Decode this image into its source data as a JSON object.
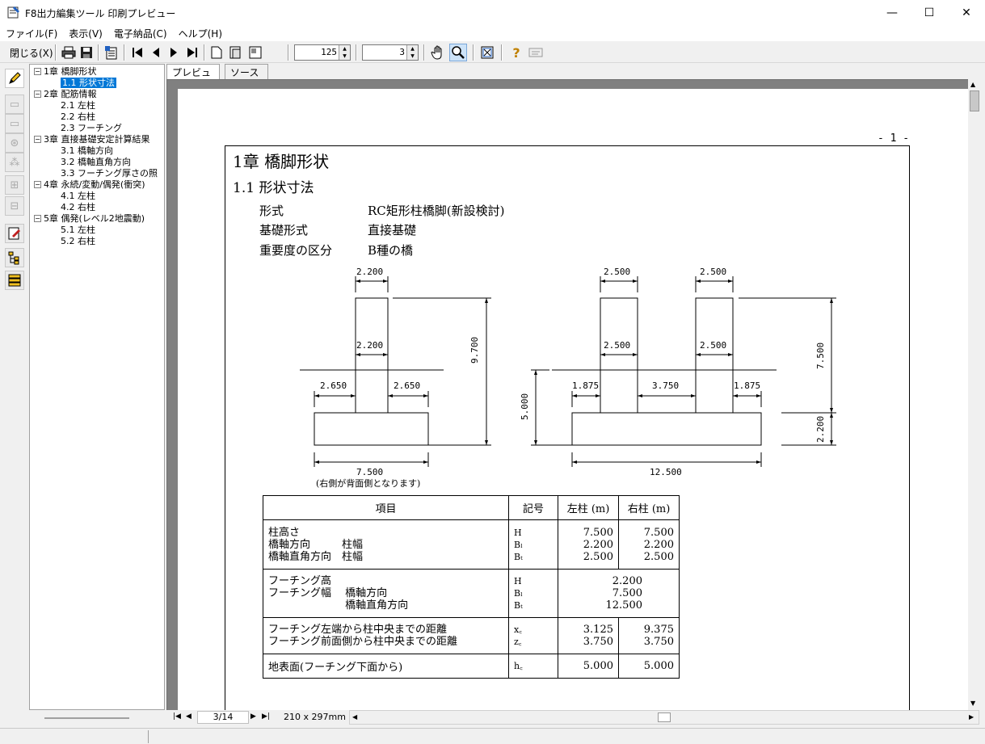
{
  "window": {
    "title": "F8出力編集ツール 印刷プレビュー",
    "minimize": "—",
    "maximize": "☐",
    "close": "✕"
  },
  "menu": [
    "ファイル(F)",
    "表示(V)",
    "電子納品(C)",
    "ヘルプ(H)"
  ],
  "toolbar": {
    "close_label": "閉じる(X)",
    "zoom_value": "125",
    "page_value": "3"
  },
  "tabs": [
    "プレビュー",
    "ソース"
  ],
  "tree": [
    {
      "label": "1章 橋脚形状",
      "level": 0,
      "box": "−"
    },
    {
      "label": "1.1 形状寸法",
      "level": 1,
      "selected": true
    },
    {
      "label": "2章 配筋情報",
      "level": 0,
      "box": "−"
    },
    {
      "label": "2.1 左柱",
      "level": 1
    },
    {
      "label": "2.2 右柱",
      "level": 1
    },
    {
      "label": "2.3 フーチング",
      "level": 1
    },
    {
      "label": "3章 直接基礎安定計算結果",
      "level": 0,
      "box": "−"
    },
    {
      "label": "3.1 橋軸方向",
      "level": 1
    },
    {
      "label": "3.2 橋軸直角方向",
      "level": 1
    },
    {
      "label": "3.3 フーチング厚さの照",
      "level": 1
    },
    {
      "label": "4章 永続/変動/偶発(衝突)",
      "level": 0,
      "box": "−"
    },
    {
      "label": "4.1 左柱",
      "level": 1
    },
    {
      "label": "4.2 右柱",
      "level": 1
    },
    {
      "label": "5章 偶発(レベル2地震動)",
      "level": 0,
      "box": "−"
    },
    {
      "label": "5.1 左柱",
      "level": 1
    },
    {
      "label": "5.2 右柱",
      "level": 1
    }
  ],
  "page": {
    "page_number": "- 1 -",
    "chapter": "1章  橋脚形状",
    "section": "1.1  形状寸法",
    "props": [
      {
        "k": "形式",
        "v": "RC矩形柱橋脚(新設検討)"
      },
      {
        "k": "基礎形式",
        "v": "直接基礎"
      },
      {
        "k": "重要度の区分",
        "v": "B種の橋"
      }
    ],
    "dims_left": {
      "top": "2.200",
      "mid": "2.200",
      "left": "2.650",
      "right": "2.650",
      "height": "9.700",
      "bottom": "7.500",
      "note": "(右側が背面側となります)"
    },
    "dims_right": {
      "top1": "2.500",
      "top2": "2.500",
      "mid1": "2.500",
      "mid2": "2.500",
      "h_left": "5.000",
      "l1": "1.875",
      "l2": "3.750",
      "l3": "1.875",
      "h_right_top": "7.500",
      "h_right_bot": "2.200",
      "bottom": "12.500"
    },
    "table": {
      "headers": [
        "項目",
        "記号",
        "左柱 (m)",
        "右柱 (m)"
      ],
      "g1": {
        "items": [
          "柱高さ",
          "橋軸方向　　　柱幅",
          "橋軸直角方向　柱幅"
        ],
        "sym": [
          "H",
          "Bₗ",
          "Bₜ"
        ],
        "left": [
          "7.500",
          "2.200",
          "2.500"
        ],
        "right": [
          "7.500",
          "2.200",
          "2.500"
        ]
      },
      "g2": {
        "items": [
          "フーチング高",
          "フーチング幅　 橋軸方向",
          "　　　　　　　 橋軸直角方向"
        ],
        "sym": [
          "H",
          "Bₗ",
          "Bₜ"
        ],
        "vals": [
          "2.200",
          "7.500",
          "12.500"
        ]
      },
      "g3": {
        "items": [
          "フーチング左端から柱中央までの距離",
          "フーチング前面側から柱中央までの距離"
        ],
        "sym": [
          "x꜀",
          "z꜀"
        ],
        "left": [
          "3.125",
          "3.750"
        ],
        "right": [
          "9.375",
          "3.750"
        ]
      },
      "g4": {
        "items": [
          "地表面(フーチング下面から)"
        ],
        "sym": [
          "h꜀"
        ],
        "left": [
          "5.000"
        ],
        "right": [
          "5.000"
        ]
      }
    }
  },
  "bottom": {
    "page_indicator": "3/14",
    "paper_size": "210 x 297mm"
  },
  "colors": {
    "selection": "#0078d7",
    "preview_bg": "#808080"
  }
}
